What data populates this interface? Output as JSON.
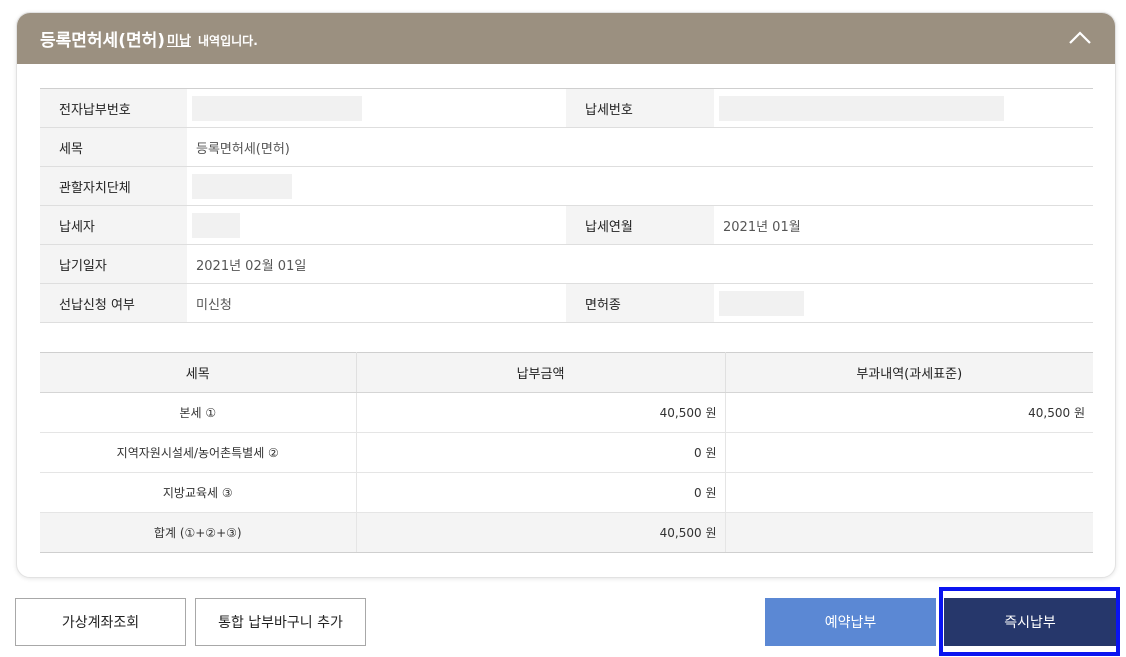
{
  "header": {
    "title": "등록면허세(면허)",
    "status": "미납",
    "status_suffix": "내역입니다.",
    "accent_color": "#9b9080"
  },
  "info": {
    "electronic_payment_no_label": "전자납부번호",
    "electronic_payment_no_value": "",
    "tax_no_label": "납세번호",
    "tax_no_value": "",
    "tax_item_label": "세목",
    "tax_item_value": "등록면허세(면허)",
    "authority_label": "관할자치단체",
    "authority_value": "",
    "taxpayer_label": "납세자",
    "taxpayer_value": "",
    "tax_month_label": "납세연월",
    "tax_month_value": "2021년 01월",
    "due_date_label": "납기일자",
    "due_date_value": "2021년 02월 01일",
    "prepay_label": "선납신청 여부",
    "prepay_value": "미신청",
    "license_type_label": "면허종",
    "license_type_value": ""
  },
  "amounts": {
    "headers": [
      "세목",
      "납부금액",
      "부과내역(과세표준)"
    ],
    "rows": [
      {
        "item": "본세 ①",
        "amount": "40,500 원",
        "basis": "40,500 원"
      },
      {
        "item": "지역자원시설세/농어촌특별세 ②",
        "amount": "0 원",
        "basis": ""
      },
      {
        "item": "지방교육세 ③",
        "amount": "0 원",
        "basis": ""
      },
      {
        "item": "합계 (①+②+③)",
        "amount": "40,500 원",
        "basis": ""
      }
    ]
  },
  "buttons": {
    "virtual_account": "가상계좌조회",
    "add_cart": "통합 납부바구니 추가",
    "reserve_pay": "예약납부",
    "pay_now": "즉시납부"
  },
  "icons": {
    "collapse": "chevron-up-icon"
  }
}
